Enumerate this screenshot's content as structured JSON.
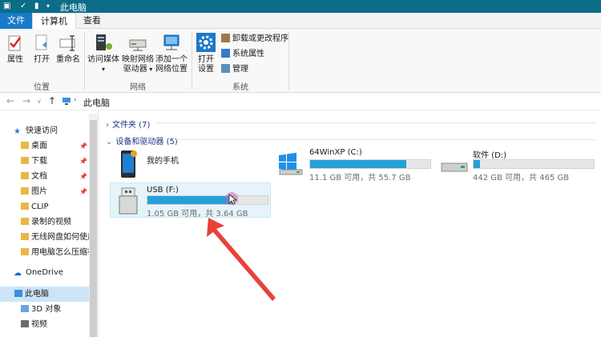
{
  "window": {
    "title": "此电脑"
  },
  "ribbon_tabs": [
    {
      "label": "文件"
    },
    {
      "label": "计算机"
    },
    {
      "label": "查看"
    }
  ],
  "ribbon": {
    "location": {
      "group_label": "位置",
      "buttons": [
        {
          "label": "属性"
        },
        {
          "label": "打开"
        },
        {
          "label": "重命名"
        }
      ]
    },
    "network": {
      "group_label": "网络",
      "access_media": "访问媒体",
      "map_drive_line1": "映射网络",
      "map_drive_line2": "驱动器",
      "add_location_line1": "添加一个",
      "add_location_line2": "网络位置"
    },
    "system": {
      "group_label": "系统",
      "open_settings_line1": "打开",
      "open_settings_line2": "设置",
      "uninstall": "卸载或更改程序",
      "system_props": "系统属性",
      "manage": "管理"
    }
  },
  "address": {
    "crumb": "此电脑"
  },
  "nav": {
    "quick_access": "快速访问",
    "items": [
      {
        "label": "桌面",
        "pinned": true
      },
      {
        "label": "下载",
        "pinned": true
      },
      {
        "label": "文档",
        "pinned": true
      },
      {
        "label": "图片",
        "pinned": true
      },
      {
        "label": "CLIP"
      },
      {
        "label": "录制的视频"
      },
      {
        "label": "无线网盘如何使用"
      },
      {
        "label": "用电脑怎么压缩视频"
      }
    ],
    "onedrive": "OneDrive",
    "this_pc": "此电脑",
    "sub_items": [
      {
        "label": "3D 对象"
      },
      {
        "label": "视频"
      }
    ]
  },
  "sections": {
    "folders": "文件夹 (7)",
    "devices": "设备和驱动器 (5)"
  },
  "devices": {
    "phone": {
      "name": "我的手机"
    },
    "drives": [
      {
        "name": "64WinXP (C:)",
        "free": "11.1 GB 可用，共 55.7 GB",
        "used_fraction": 0.8
      },
      {
        "name": "软件 (D:)",
        "free": "442 GB 可用，共 465 GB",
        "used_fraction": 0.05
      },
      {
        "name": "USB (F:)",
        "free": "1.05 GB 可用，共 3.64 GB",
        "used_fraction": 0.71
      }
    ]
  },
  "colors": {
    "titlebar": "#0c6d89",
    "file_tab": "#1979ca",
    "drive_fill": "#26a0da",
    "annotation_arrow": "#e8423b"
  }
}
